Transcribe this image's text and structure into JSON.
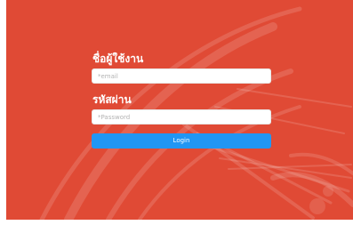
{
  "colors": {
    "background": "#e04a35",
    "accent_button": "#2196f3",
    "text": "#ffffff"
  },
  "login_form": {
    "username_label": "ชื่อผู้ใช้งาน",
    "email_placeholder": "*email",
    "email_value": "",
    "password_label": "รหัสผ่าน",
    "password_placeholder": "*Password",
    "password_value": "",
    "login_label": "Login"
  },
  "background": {
    "watermark_icon": "emblem-watermark"
  }
}
